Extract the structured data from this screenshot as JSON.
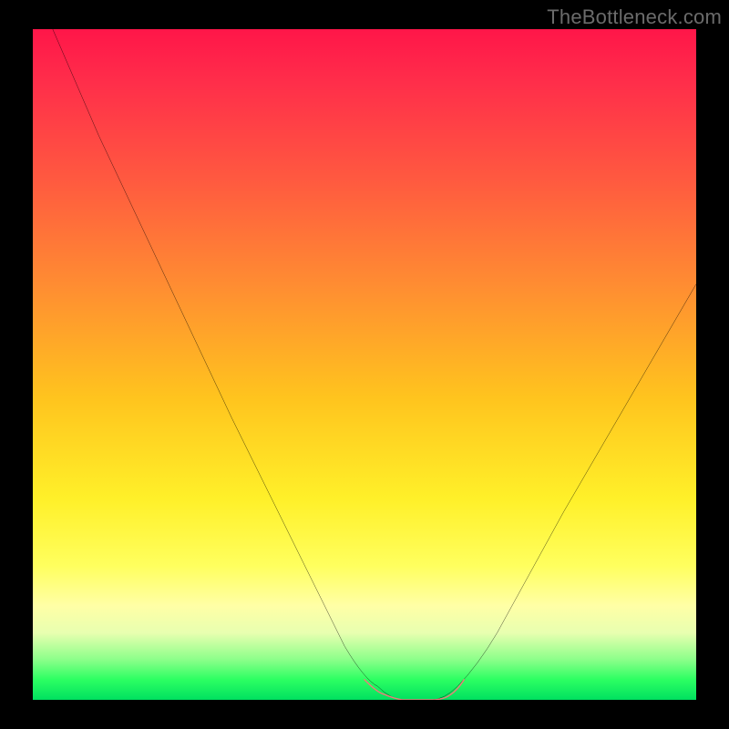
{
  "watermark": {
    "text": "TheBottleneck.com"
  },
  "chart_data": {
    "type": "line",
    "title": "",
    "xlabel": "",
    "ylabel": "",
    "xlim": [
      0,
      100
    ],
    "ylim": [
      0,
      100
    ],
    "series": [
      {
        "name": "black-curve",
        "x": [
          3,
          10,
          20,
          30,
          40,
          47,
          52,
          56,
          60,
          64,
          70,
          80,
          90,
          100
        ],
        "values": [
          100,
          84,
          63,
          42,
          22,
          8,
          2,
          0,
          0,
          2,
          10,
          28,
          45,
          62
        ]
      },
      {
        "name": "pink-valley-band",
        "x": [
          50,
          53,
          56,
          60,
          63,
          65
        ],
        "values": [
          3,
          1,
          0,
          0,
          1,
          3
        ]
      }
    ],
    "annotations": []
  }
}
